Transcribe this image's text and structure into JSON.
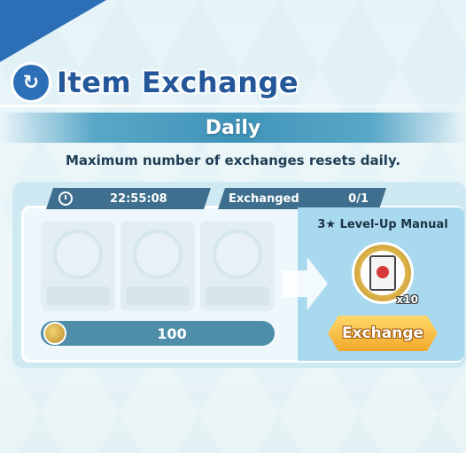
{
  "header": {
    "title": "Item Exchange",
    "icon": "exchange-arrows-icon"
  },
  "section": {
    "banner": "Daily",
    "subtitle": "Maximum number of exchanges resets daily."
  },
  "card": {
    "timer": "22:55:08",
    "exchanged_label": "Exchanged",
    "exchanged_count": "0/1",
    "cost": "100",
    "reward_name": "3★ Level-Up Manual",
    "reward_quantity": "x10",
    "exchange_button": "Exchange"
  },
  "colors": {
    "title": "#23579a",
    "accent": "#2c6fb6",
    "button": "#f3a92a"
  }
}
